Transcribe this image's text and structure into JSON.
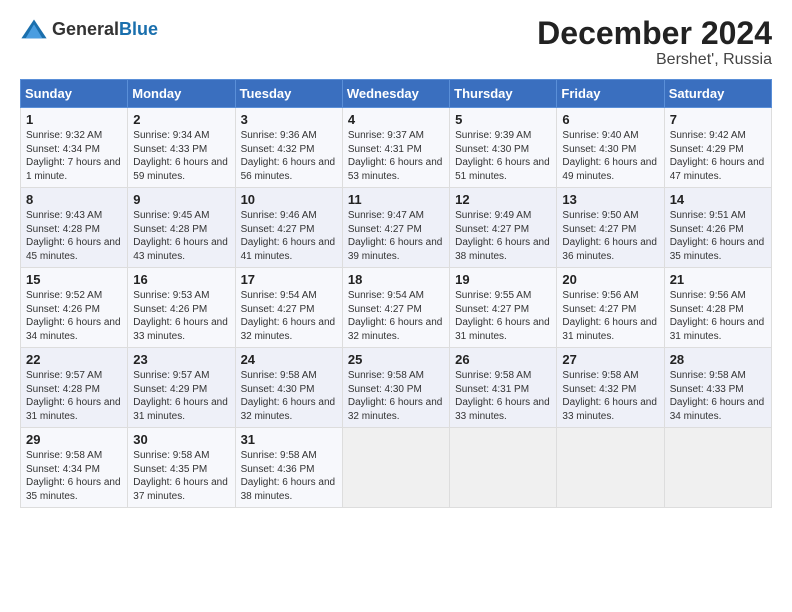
{
  "header": {
    "logo_general": "General",
    "logo_blue": "Blue",
    "title": "December 2024",
    "subtitle": "Bershet', Russia"
  },
  "days_of_week": [
    "Sunday",
    "Monday",
    "Tuesday",
    "Wednesday",
    "Thursday",
    "Friday",
    "Saturday"
  ],
  "weeks": [
    [
      {
        "day": "1",
        "sunrise": "9:32 AM",
        "sunset": "4:34 PM",
        "daylight": "7 hours and 1 minute."
      },
      {
        "day": "2",
        "sunrise": "9:34 AM",
        "sunset": "4:33 PM",
        "daylight": "6 hours and 59 minutes."
      },
      {
        "day": "3",
        "sunrise": "9:36 AM",
        "sunset": "4:32 PM",
        "daylight": "6 hours and 56 minutes."
      },
      {
        "day": "4",
        "sunrise": "9:37 AM",
        "sunset": "4:31 PM",
        "daylight": "6 hours and 53 minutes."
      },
      {
        "day": "5",
        "sunrise": "9:39 AM",
        "sunset": "4:30 PM",
        "daylight": "6 hours and 51 minutes."
      },
      {
        "day": "6",
        "sunrise": "9:40 AM",
        "sunset": "4:30 PM",
        "daylight": "6 hours and 49 minutes."
      },
      {
        "day": "7",
        "sunrise": "9:42 AM",
        "sunset": "4:29 PM",
        "daylight": "6 hours and 47 minutes."
      }
    ],
    [
      {
        "day": "8",
        "sunrise": "9:43 AM",
        "sunset": "4:28 PM",
        "daylight": "6 hours and 45 minutes."
      },
      {
        "day": "9",
        "sunrise": "9:45 AM",
        "sunset": "4:28 PM",
        "daylight": "6 hours and 43 minutes."
      },
      {
        "day": "10",
        "sunrise": "9:46 AM",
        "sunset": "4:27 PM",
        "daylight": "6 hours and 41 minutes."
      },
      {
        "day": "11",
        "sunrise": "9:47 AM",
        "sunset": "4:27 PM",
        "daylight": "6 hours and 39 minutes."
      },
      {
        "day": "12",
        "sunrise": "9:49 AM",
        "sunset": "4:27 PM",
        "daylight": "6 hours and 38 minutes."
      },
      {
        "day": "13",
        "sunrise": "9:50 AM",
        "sunset": "4:27 PM",
        "daylight": "6 hours and 36 minutes."
      },
      {
        "day": "14",
        "sunrise": "9:51 AM",
        "sunset": "4:26 PM",
        "daylight": "6 hours and 35 minutes."
      }
    ],
    [
      {
        "day": "15",
        "sunrise": "9:52 AM",
        "sunset": "4:26 PM",
        "daylight": "6 hours and 34 minutes."
      },
      {
        "day": "16",
        "sunrise": "9:53 AM",
        "sunset": "4:26 PM",
        "daylight": "6 hours and 33 minutes."
      },
      {
        "day": "17",
        "sunrise": "9:54 AM",
        "sunset": "4:27 PM",
        "daylight": "6 hours and 32 minutes."
      },
      {
        "day": "18",
        "sunrise": "9:54 AM",
        "sunset": "4:27 PM",
        "daylight": "6 hours and 32 minutes."
      },
      {
        "day": "19",
        "sunrise": "9:55 AM",
        "sunset": "4:27 PM",
        "daylight": "6 hours and 31 minutes."
      },
      {
        "day": "20",
        "sunrise": "9:56 AM",
        "sunset": "4:27 PM",
        "daylight": "6 hours and 31 minutes."
      },
      {
        "day": "21",
        "sunrise": "9:56 AM",
        "sunset": "4:28 PM",
        "daylight": "6 hours and 31 minutes."
      }
    ],
    [
      {
        "day": "22",
        "sunrise": "9:57 AM",
        "sunset": "4:28 PM",
        "daylight": "6 hours and 31 minutes."
      },
      {
        "day": "23",
        "sunrise": "9:57 AM",
        "sunset": "4:29 PM",
        "daylight": "6 hours and 31 minutes."
      },
      {
        "day": "24",
        "sunrise": "9:58 AM",
        "sunset": "4:30 PM",
        "daylight": "6 hours and 32 minutes."
      },
      {
        "day": "25",
        "sunrise": "9:58 AM",
        "sunset": "4:30 PM",
        "daylight": "6 hours and 32 minutes."
      },
      {
        "day": "26",
        "sunrise": "9:58 AM",
        "sunset": "4:31 PM",
        "daylight": "6 hours and 33 minutes."
      },
      {
        "day": "27",
        "sunrise": "9:58 AM",
        "sunset": "4:32 PM",
        "daylight": "6 hours and 33 minutes."
      },
      {
        "day": "28",
        "sunrise": "9:58 AM",
        "sunset": "4:33 PM",
        "daylight": "6 hours and 34 minutes."
      }
    ],
    [
      {
        "day": "29",
        "sunrise": "9:58 AM",
        "sunset": "4:34 PM",
        "daylight": "6 hours and 35 minutes."
      },
      {
        "day": "30",
        "sunrise": "9:58 AM",
        "sunset": "4:35 PM",
        "daylight": "6 hours and 37 minutes."
      },
      {
        "day": "31",
        "sunrise": "9:58 AM",
        "sunset": "4:36 PM",
        "daylight": "6 hours and 38 minutes."
      },
      null,
      null,
      null,
      null
    ]
  ],
  "labels": {
    "sunrise": "Sunrise:",
    "sunset": "Sunset:",
    "daylight": "Daylight:"
  }
}
